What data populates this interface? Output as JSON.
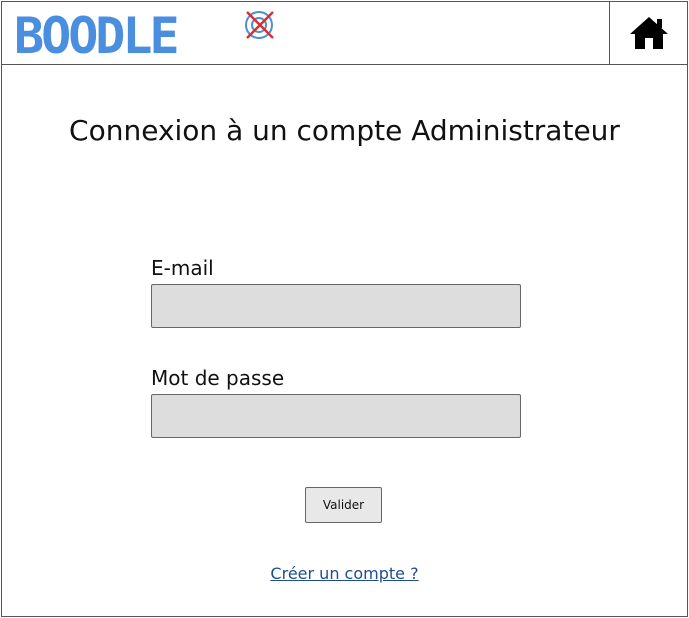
{
  "header": {
    "logo_text": "BOODLE",
    "logo_icon": "crossed-target-icon",
    "home_icon": "home-icon"
  },
  "page": {
    "title": "Connexion à un compte Administrateur"
  },
  "form": {
    "email_label": "E-mail",
    "email_value": "",
    "password_label": "Mot de passe",
    "password_value": "",
    "submit_label": "Valider"
  },
  "footer": {
    "create_account_link": "Créer un compte ?"
  },
  "colors": {
    "logo": "#4a8ee0",
    "logo_mark_cross": "#d83030",
    "input_background": "#dddddd",
    "link": "#1f4e8c"
  }
}
